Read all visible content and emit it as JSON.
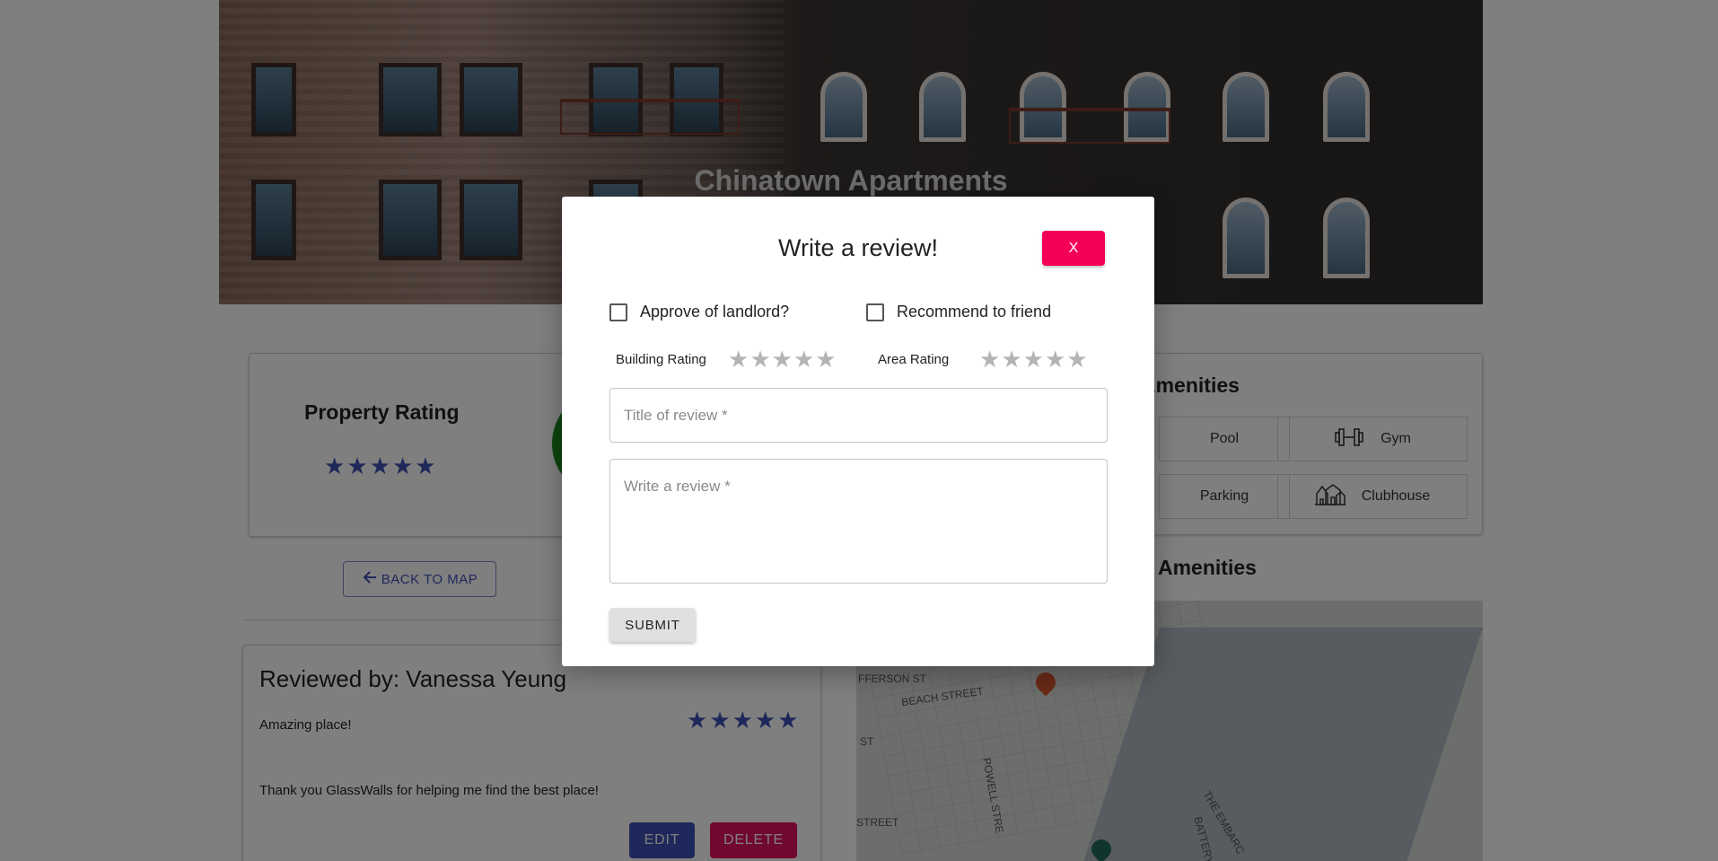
{
  "hero": {
    "title": "Chinatown Apartments"
  },
  "property": {
    "rating_title": "Property Rating",
    "rating_stars": 5
  },
  "amenities": {
    "title": "Amenities",
    "items": [
      "Pool",
      "Gym",
      "Parking",
      "Clubhouse"
    ]
  },
  "nearby": {
    "title": "Amenities"
  },
  "map": {
    "streets": [
      "FFERSON ST",
      "BEACH STREET",
      "ST",
      "STREET",
      "POWELL STRE",
      "THE EMBARC",
      "BATTERY"
    ]
  },
  "nav": {
    "back_label": "BACK TO MAP"
  },
  "review": {
    "reviewed_by": "Reviewed by: Vanessa Yeung",
    "title": "Amazing place!",
    "body": "Thank you GlassWalls for helping me find the best place!",
    "stars": 5,
    "edit_label": "EDIT",
    "delete_label": "DELETE"
  },
  "modal": {
    "title": "Write a review!",
    "close_label": "X",
    "approve_label": "Approve of landlord?",
    "recommend_label": "Recommend to friend",
    "building_rating_label": "Building Rating",
    "area_rating_label": "Area Rating",
    "building_rating_value": 0,
    "area_rating_value": 0,
    "title_placeholder": "Title of review *",
    "review_placeholder": "Write a review *",
    "submit_label": "SUBMIT"
  },
  "colors": {
    "primary": "#3f51b5",
    "secondary": "#f50057",
    "delete": "#e0115f",
    "star_empty": "#b4b4b4"
  }
}
